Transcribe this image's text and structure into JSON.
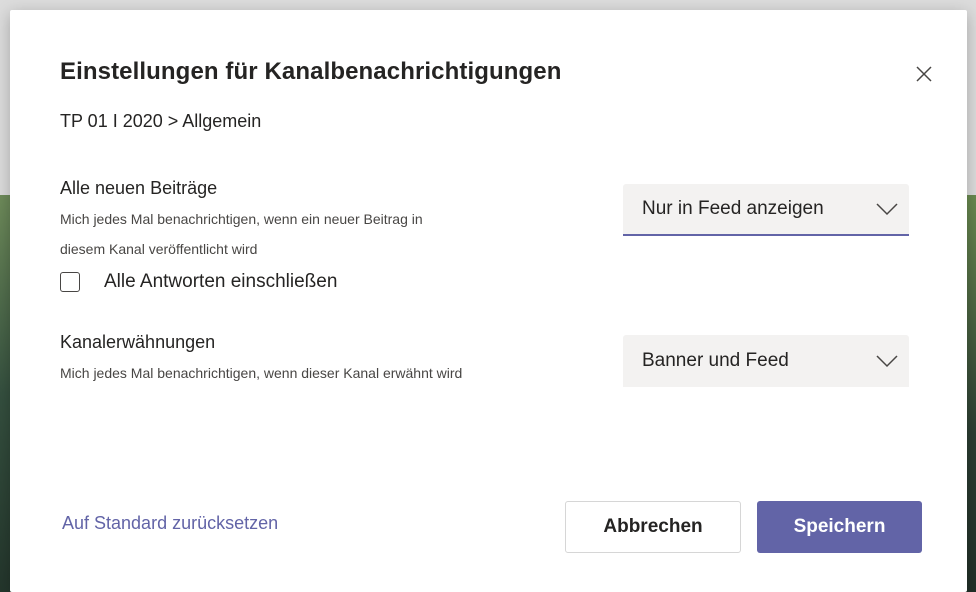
{
  "dialog": {
    "title": "Einstellungen für Kanalbenachrichtigungen",
    "breadcrumb": "TP 01 I 2020 > Allgemein",
    "close_icon": "close-icon"
  },
  "new_posts": {
    "title": "Alle neuen Beiträge",
    "description_line1": "Mich jedes Mal benachrichtigen, wenn ein neuer Beitrag in",
    "description_line2": "diesem Kanal veröffentlicht wird",
    "dropdown_value": "Nur in Feed anzeigen",
    "checkbox_label": "Alle Antworten einschließen",
    "checkbox_checked": false
  },
  "channel_mentions": {
    "title": "Kanalerwähnungen",
    "description": "Mich jedes Mal benachrichtigen, wenn dieser Kanal erwähnt wird",
    "dropdown_value": "Banner und Feed"
  },
  "footer": {
    "reset_label": "Auf Standard zurücksetzen",
    "cancel_label": "Abbrechen",
    "save_label": "Speichern"
  },
  "colors": {
    "accent": "#6264a7",
    "text": "#252423",
    "dropdown_bg": "#f3f2f1"
  }
}
